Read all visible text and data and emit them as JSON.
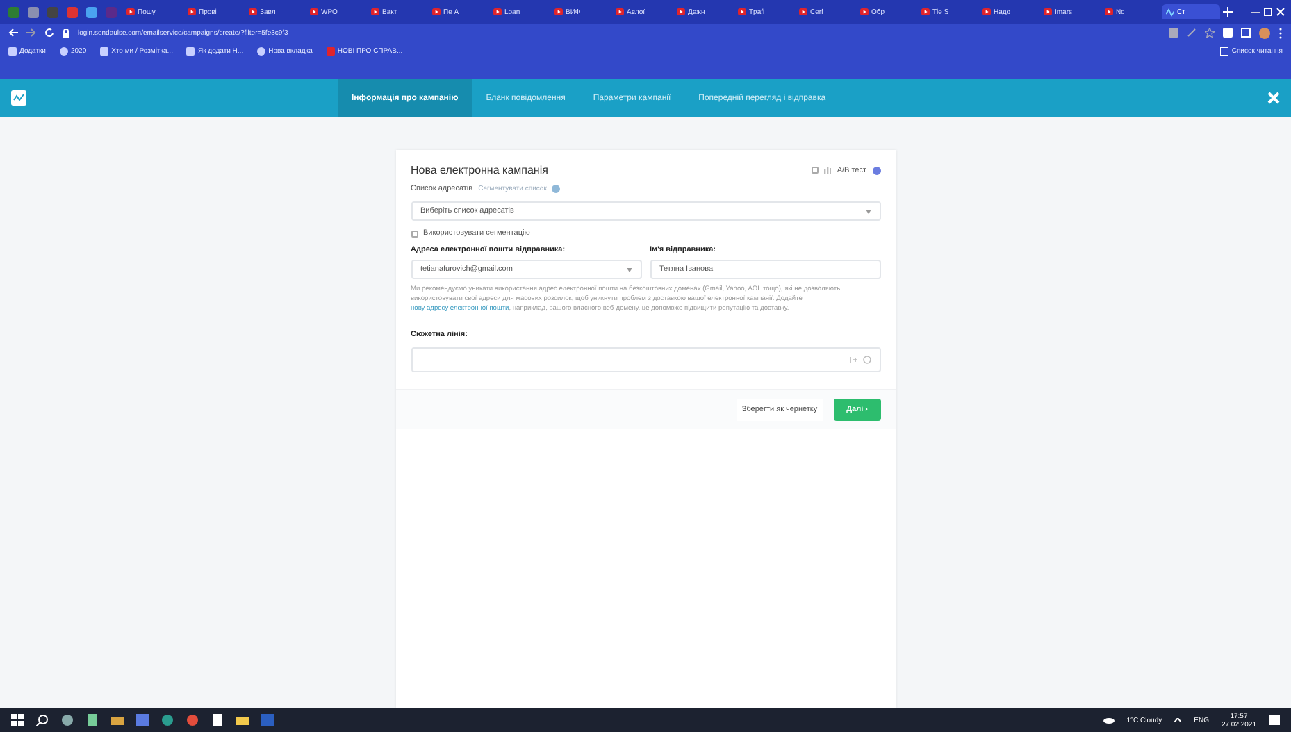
{
  "browser": {
    "tabs": [
      {
        "label": "Пошу",
        "selected": false
      },
      {
        "label": "Прові",
        "selected": false
      },
      {
        "label": "Завл",
        "selected": false
      },
      {
        "label": "WPO",
        "selected": false
      },
      {
        "label": "Вакт",
        "selected": false
      },
      {
        "label": "Пе А",
        "selected": false
      },
      {
        "label": "Loan",
        "selected": false
      },
      {
        "label": "ВИФ",
        "selected": false
      },
      {
        "label": "Авлої",
        "selected": false
      },
      {
        "label": "Дежн",
        "selected": false
      },
      {
        "label": "Tpafi",
        "selected": false
      },
      {
        "label": "Cerf",
        "selected": false
      },
      {
        "label": "Обр",
        "selected": false
      },
      {
        "label": "Tle S",
        "selected": false
      },
      {
        "label": "Надо",
        "selected": false
      },
      {
        "label": "Imars",
        "selected": false
      },
      {
        "label": "Nc",
        "selected": false
      },
      {
        "label": "Ст",
        "selected": true
      }
    ],
    "address": "login.sendpulse.com/emailservice/campaigns/create/?filter=5fe3c9f3",
    "bookmarks": [
      "Додатки",
      "2020",
      "Хто ми / Розмітка...",
      "Як додати Н...",
      "Нова вкладка",
      "НОВІ ПРО СПРАВ..."
    ],
    "reading_list": "Список читання"
  },
  "nav": {
    "tabs": [
      {
        "label": "Інформація про кампанію",
        "selected": true
      },
      {
        "label": "Бланк повідомлення",
        "selected": false
      },
      {
        "label": "Параметри кампанії",
        "selected": false
      },
      {
        "label": "Попередній перегляд і відправка",
        "selected": false
      }
    ]
  },
  "campaign": {
    "title": "Нова електронна кампанія",
    "ab_test": {
      "label": "A/B тест",
      "checked": false
    },
    "list_label": "Список адресатів",
    "list_link": "Сегментувати список",
    "list_placeholder": "Виберіть список адресатів",
    "segmentation": {
      "label": "Використовувати сегментацію",
      "checked": false
    },
    "sender_email_label": "Адреса електронної пошти відправника:",
    "sender_email": "tetianafurovich@gmail.com",
    "sender_name_label": "Ім'я відправника:",
    "sender_name": "Тетяна Іванова",
    "help_before": "Ми рекомендуємо уникати використання адрес електронної пошти на безкоштовних доменах (Gmail, Yahoo, AOL тощо), які не дозволяють використовувати свої адреси для масових розсилок, щоб уникнути проблем з доставкою вашої електронної кампанії. Додайте",
    "help_link": "нову адресу електронної пошти",
    "help_after": ", наприклад, вашого власного веб-домену, це допоможе підвищити репутацію та доставку.",
    "subject_label": "Сюжетна лінія:",
    "save_label": "Зберегти як чернетку",
    "next_label": "Далі ›"
  },
  "taskbar": {
    "weather": "1°C Cloudy",
    "language": "ENG",
    "time": "17:57",
    "date": "27.02.2021"
  }
}
